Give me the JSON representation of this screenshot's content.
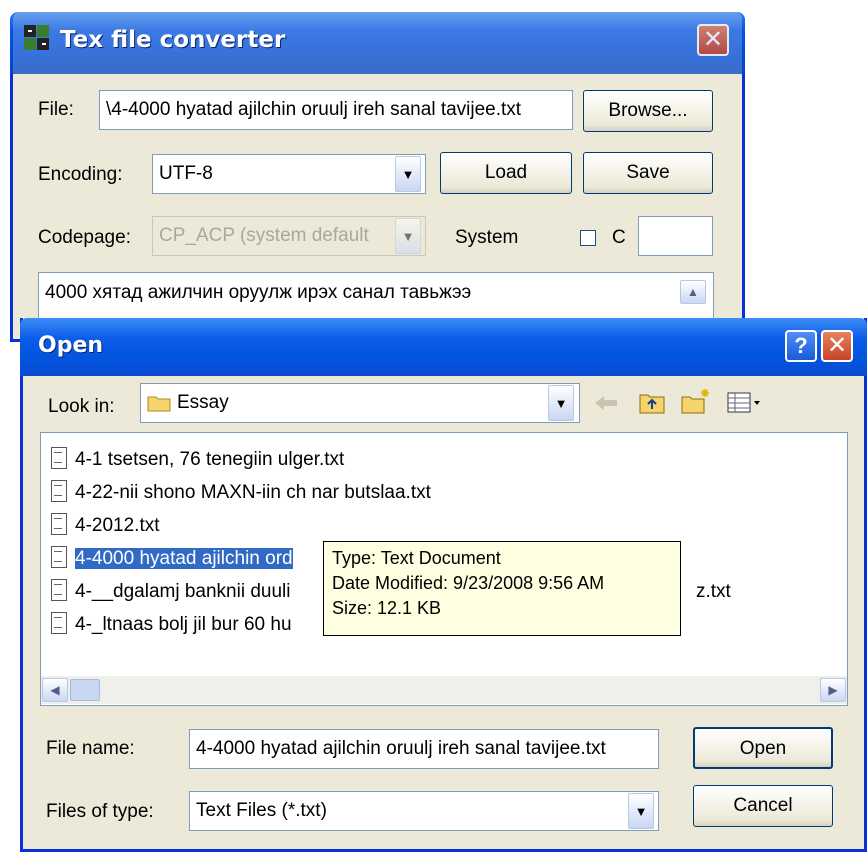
{
  "converter": {
    "title": "Tex file converter",
    "file_label": "File:",
    "file_value": "\\4-4000 hyatad ajilchin oruulj ireh sanal tavijee.txt",
    "browse_label": "Browse...",
    "encoding_label": "Encoding:",
    "encoding_value": "UTF-8",
    "load_label": "Load",
    "save_label": "Save",
    "codepage_label": "Codepage:",
    "codepage_value": "CP_ACP (system default",
    "system_label": "System",
    "c_label": "C",
    "c_value": "",
    "text_preview": "4000 хятад ажилчин оруулж ирэх санал тавьжээ"
  },
  "open_dialog": {
    "title": "Open",
    "help_label": "?",
    "look_in_label": "Look in:",
    "look_in_value": "Essay",
    "files": [
      {
        "name": "4-1 tsetsen, 76 tenegiin ulger.txt"
      },
      {
        "name": "4-22-nii shono MAXN-iin ch nar butslaa.txt"
      },
      {
        "name": "4-2012.txt"
      },
      {
        "name": "4-4000 hyatad ajilchin ord"
      },
      {
        "name": "4-__dgalamj banknii duuli",
        "suffix": "z.txt"
      },
      {
        "name": "4-_ltnaas bolj jil bur 60 hu"
      }
    ],
    "selected_index": 3,
    "tooltip": {
      "type": "Type: Text Document",
      "modified": "Date Modified: 9/23/2008 9:56 AM",
      "size": "Size: 12.1 KB"
    },
    "file_name_label": "File name:",
    "file_name_value": "4-4000 hyatad ajilchin oruulj ireh sanal tavijee.txt",
    "files_of_type_label": "Files of type:",
    "files_of_type_value": "Text Files (*.txt)",
    "open_label": "Open",
    "cancel_label": "Cancel"
  },
  "colors": {
    "titlebar": "#0a5ce9",
    "selection": "#316ac5",
    "dialog_bg": "#ece9d8",
    "tooltip_bg": "#ffffe1"
  }
}
